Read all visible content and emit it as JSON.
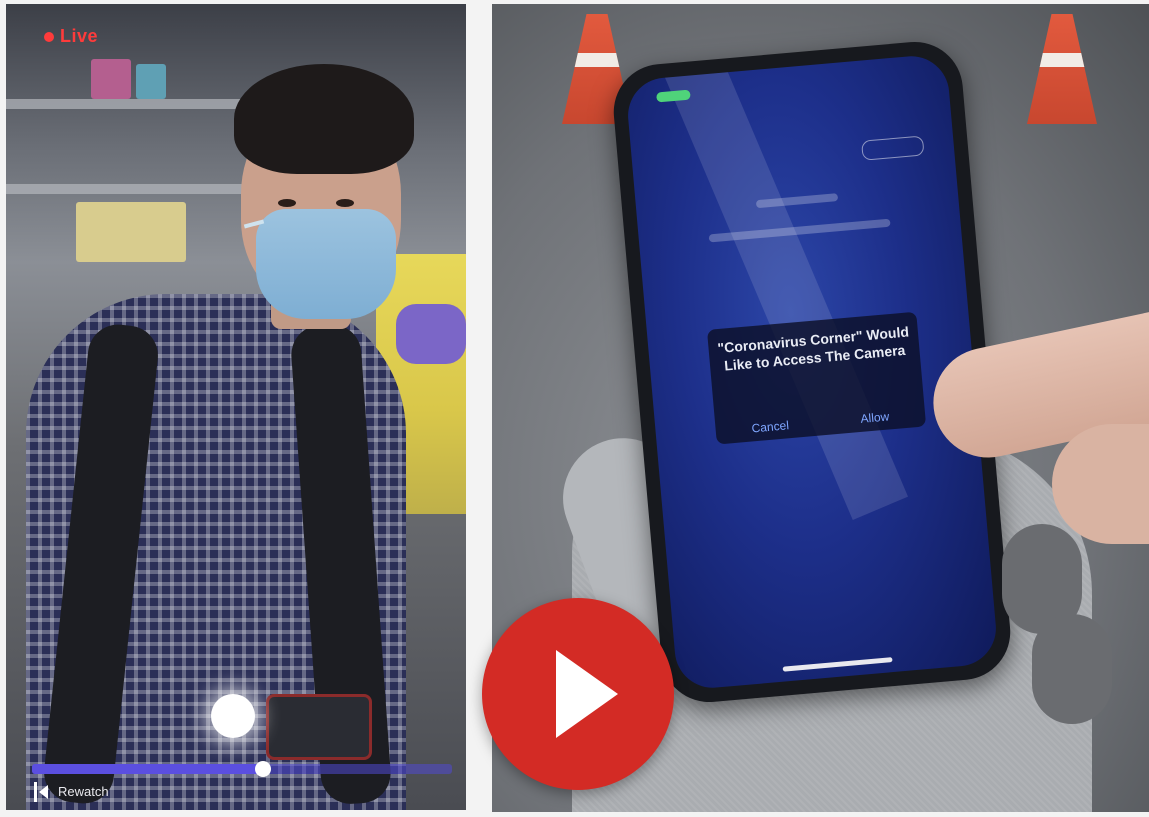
{
  "left_video": {
    "live_label": "Live",
    "bottom_label": "Rewatch",
    "progress": 0.55
  },
  "right_image": {
    "phone_alert": {
      "title": "\"Coronavirus Corner\" Would Like to Access The Camera",
      "cancel_label": "Cancel",
      "allow_label": "Allow"
    }
  },
  "play_button": {
    "icon": "play-icon",
    "color": "#d32b25"
  }
}
